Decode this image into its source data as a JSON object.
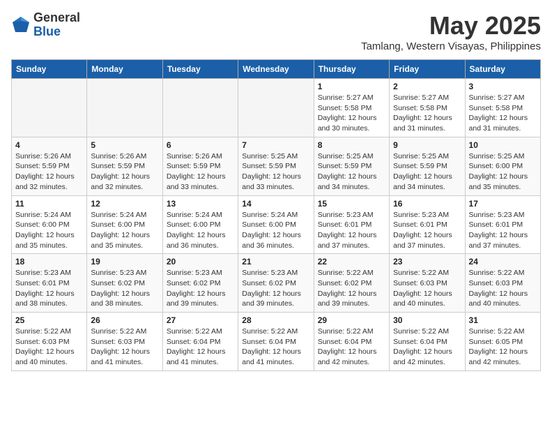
{
  "header": {
    "logo_general": "General",
    "logo_blue": "Blue",
    "month": "May 2025",
    "location": "Tamlang, Western Visayas, Philippines"
  },
  "weekdays": [
    "Sunday",
    "Monday",
    "Tuesday",
    "Wednesday",
    "Thursday",
    "Friday",
    "Saturday"
  ],
  "weeks": [
    [
      {
        "day": "",
        "info": ""
      },
      {
        "day": "",
        "info": ""
      },
      {
        "day": "",
        "info": ""
      },
      {
        "day": "",
        "info": ""
      },
      {
        "day": "1",
        "info": "Sunrise: 5:27 AM\nSunset: 5:58 PM\nDaylight: 12 hours and 30 minutes."
      },
      {
        "day": "2",
        "info": "Sunrise: 5:27 AM\nSunset: 5:58 PM\nDaylight: 12 hours and 31 minutes."
      },
      {
        "day": "3",
        "info": "Sunrise: 5:27 AM\nSunset: 5:58 PM\nDaylight: 12 hours and 31 minutes."
      }
    ],
    [
      {
        "day": "4",
        "info": "Sunrise: 5:26 AM\nSunset: 5:59 PM\nDaylight: 12 hours and 32 minutes."
      },
      {
        "day": "5",
        "info": "Sunrise: 5:26 AM\nSunset: 5:59 PM\nDaylight: 12 hours and 32 minutes."
      },
      {
        "day": "6",
        "info": "Sunrise: 5:26 AM\nSunset: 5:59 PM\nDaylight: 12 hours and 33 minutes."
      },
      {
        "day": "7",
        "info": "Sunrise: 5:25 AM\nSunset: 5:59 PM\nDaylight: 12 hours and 33 minutes."
      },
      {
        "day": "8",
        "info": "Sunrise: 5:25 AM\nSunset: 5:59 PM\nDaylight: 12 hours and 34 minutes."
      },
      {
        "day": "9",
        "info": "Sunrise: 5:25 AM\nSunset: 5:59 PM\nDaylight: 12 hours and 34 minutes."
      },
      {
        "day": "10",
        "info": "Sunrise: 5:25 AM\nSunset: 6:00 PM\nDaylight: 12 hours and 35 minutes."
      }
    ],
    [
      {
        "day": "11",
        "info": "Sunrise: 5:24 AM\nSunset: 6:00 PM\nDaylight: 12 hours and 35 minutes."
      },
      {
        "day": "12",
        "info": "Sunrise: 5:24 AM\nSunset: 6:00 PM\nDaylight: 12 hours and 35 minutes."
      },
      {
        "day": "13",
        "info": "Sunrise: 5:24 AM\nSunset: 6:00 PM\nDaylight: 12 hours and 36 minutes."
      },
      {
        "day": "14",
        "info": "Sunrise: 5:24 AM\nSunset: 6:00 PM\nDaylight: 12 hours and 36 minutes."
      },
      {
        "day": "15",
        "info": "Sunrise: 5:23 AM\nSunset: 6:01 PM\nDaylight: 12 hours and 37 minutes."
      },
      {
        "day": "16",
        "info": "Sunrise: 5:23 AM\nSunset: 6:01 PM\nDaylight: 12 hours and 37 minutes."
      },
      {
        "day": "17",
        "info": "Sunrise: 5:23 AM\nSunset: 6:01 PM\nDaylight: 12 hours and 37 minutes."
      }
    ],
    [
      {
        "day": "18",
        "info": "Sunrise: 5:23 AM\nSunset: 6:01 PM\nDaylight: 12 hours and 38 minutes."
      },
      {
        "day": "19",
        "info": "Sunrise: 5:23 AM\nSunset: 6:02 PM\nDaylight: 12 hours and 38 minutes."
      },
      {
        "day": "20",
        "info": "Sunrise: 5:23 AM\nSunset: 6:02 PM\nDaylight: 12 hours and 39 minutes."
      },
      {
        "day": "21",
        "info": "Sunrise: 5:23 AM\nSunset: 6:02 PM\nDaylight: 12 hours and 39 minutes."
      },
      {
        "day": "22",
        "info": "Sunrise: 5:22 AM\nSunset: 6:02 PM\nDaylight: 12 hours and 39 minutes."
      },
      {
        "day": "23",
        "info": "Sunrise: 5:22 AM\nSunset: 6:03 PM\nDaylight: 12 hours and 40 minutes."
      },
      {
        "day": "24",
        "info": "Sunrise: 5:22 AM\nSunset: 6:03 PM\nDaylight: 12 hours and 40 minutes."
      }
    ],
    [
      {
        "day": "25",
        "info": "Sunrise: 5:22 AM\nSunset: 6:03 PM\nDaylight: 12 hours and 40 minutes."
      },
      {
        "day": "26",
        "info": "Sunrise: 5:22 AM\nSunset: 6:03 PM\nDaylight: 12 hours and 41 minutes."
      },
      {
        "day": "27",
        "info": "Sunrise: 5:22 AM\nSunset: 6:04 PM\nDaylight: 12 hours and 41 minutes."
      },
      {
        "day": "28",
        "info": "Sunrise: 5:22 AM\nSunset: 6:04 PM\nDaylight: 12 hours and 41 minutes."
      },
      {
        "day": "29",
        "info": "Sunrise: 5:22 AM\nSunset: 6:04 PM\nDaylight: 12 hours and 42 minutes."
      },
      {
        "day": "30",
        "info": "Sunrise: 5:22 AM\nSunset: 6:04 PM\nDaylight: 12 hours and 42 minutes."
      },
      {
        "day": "31",
        "info": "Sunrise: 5:22 AM\nSunset: 6:05 PM\nDaylight: 12 hours and 42 minutes."
      }
    ]
  ]
}
